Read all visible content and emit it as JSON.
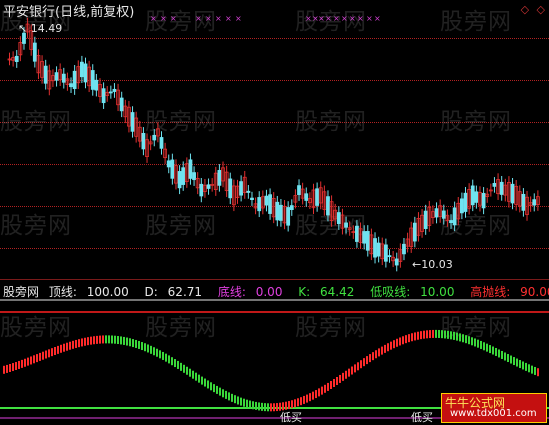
{
  "title": "平安银行(日线,前复权)",
  "top_icons": [
    "◇",
    "◇"
  ],
  "top_icon_color": "#cc3333",
  "watermark_text": "股旁网",
  "price": {
    "high_label": "14.49",
    "low_label": "10.03",
    "up_color": "#e23030",
    "down_color": "#6fe3f0",
    "marker_color": "#d040d0"
  },
  "indicator": {
    "name": "股旁网",
    "items": [
      {
        "label": "顶线:",
        "value": "100.00",
        "color": "#e8e8e8"
      },
      {
        "label": "D:",
        "value": "62.71",
        "color": "#e8e8e8"
      },
      {
        "label": "底线:",
        "value": "0.00",
        "color": "#e040e0"
      },
      {
        "label": "K:",
        "value": "64.42",
        "color": "#40e040"
      },
      {
        "label": "低吸线:",
        "value": "10.00",
        "color": "#40e040"
      },
      {
        "label": "高抛线:",
        "value": "90.00",
        "color": "#ff3030"
      }
    ],
    "signal_labels": [
      "低买",
      "低买"
    ]
  },
  "logo": {
    "line1": "牛牛公式网",
    "line2": "www.tdx001.com"
  },
  "chart_data": {
    "type": "candlestick",
    "series": [
      {
        "values": [
          13.9,
          14.49,
          13.8,
          13.5,
          13.6,
          13.4,
          13.7,
          13.5,
          13.2,
          13.3,
          12.9,
          12.6,
          12.2,
          12.5,
          11.9,
          11.6,
          11.8,
          11.4,
          11.5,
          11.7,
          11.3,
          11.5,
          11.1,
          11.2,
          11.0,
          10.9,
          11.4,
          11.2,
          11.3,
          11.0,
          10.8,
          10.6,
          10.5,
          10.3,
          10.2,
          10.03,
          10.4,
          10.7,
          10.9,
          11.0,
          10.8,
          11.1,
          11.3,
          11.2,
          11.5,
          11.4,
          11.3,
          11.1,
          11.2
        ]
      }
    ],
    "y_range": [
      10.03,
      14.49
    ]
  }
}
